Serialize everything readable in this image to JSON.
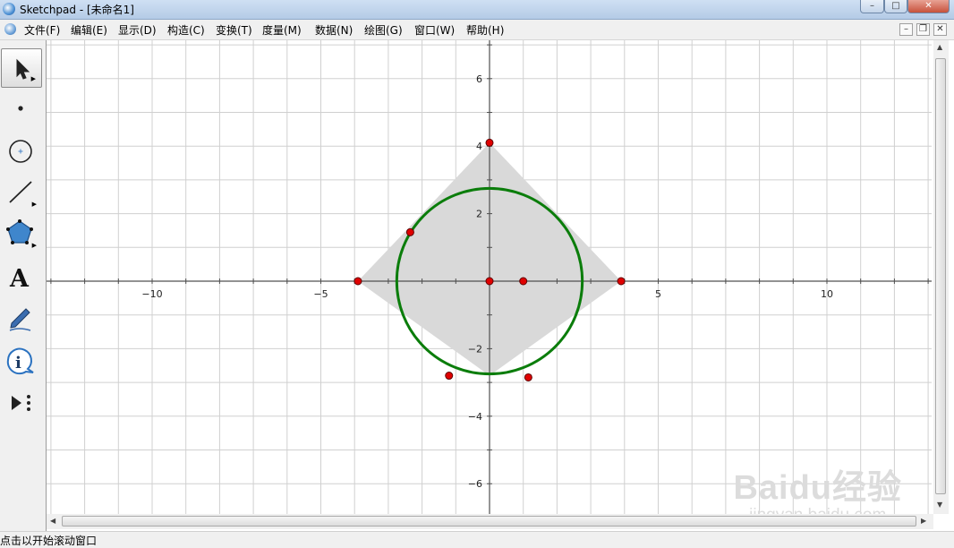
{
  "window": {
    "title": "Sketchpad  - [未命名1]"
  },
  "menu": [
    "文件(F)",
    "编辑(E)",
    "显示(D)",
    "构造(C)",
    "变换(T)",
    "度量(M)",
    "数据(N)",
    "绘图(G)",
    "窗口(W)",
    "帮助(H)"
  ],
  "tools": [
    "arrow-select",
    "point",
    "compass",
    "straightedge",
    "polygon",
    "text",
    "marker",
    "information",
    "custom-tools"
  ],
  "tool_text_glyph": "A",
  "axis": {
    "x_ticks": [
      "−10",
      "−5",
      "5",
      "10"
    ],
    "y_ticks": [
      "6",
      "4",
      "2",
      "−2",
      "−4",
      "−6"
    ]
  },
  "sketch": {
    "square_vertices": [
      [
        0,
        4.1
      ],
      [
        3.9,
        0
      ],
      [
        0,
        -2.8
      ],
      [
        -3.9,
        0
      ]
    ],
    "circle": {
      "center": [
        0,
        0
      ],
      "radius": 2.75
    },
    "points": [
      [
        0,
        4.1
      ],
      [
        -2.35,
        1.45
      ],
      [
        -3.9,
        0
      ],
      [
        0,
        0
      ],
      [
        1.0,
        0
      ],
      [
        3.9,
        0
      ],
      [
        -1.2,
        -2.8
      ],
      [
        1.15,
        -2.85
      ]
    ],
    "colors": {
      "circle": "#0b7d0b",
      "point": "#e00000",
      "fill": "#d9d9d9",
      "grid": "#d0d0d0",
      "axis": "#505050"
    }
  },
  "statusbar": {
    "text": "点击以开始滚动窗口"
  },
  "watermark": {
    "logo": "Baidu经验",
    "url": "jingyan.baidu.com"
  }
}
